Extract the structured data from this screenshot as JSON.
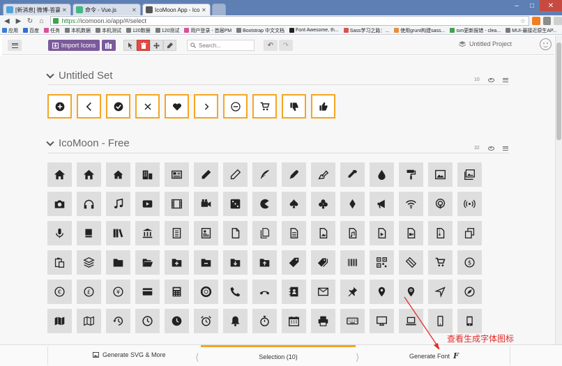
{
  "browser": {
    "tabs": [
      {
        "title": "[新消息] 微博-答赢职业人",
        "favicon_color": "#4fa3d9",
        "active": false
      },
      {
        "title": "命令 - Vue.js",
        "favicon_color": "#42b883",
        "active": false
      },
      {
        "title": "IcoMoon App - Icon Fo",
        "favicon_color": "#555555",
        "active": true
      }
    ],
    "url_https": "https://",
    "url_rest": "icomoon.io/app/#/select",
    "bookmarks": [
      {
        "label": "应用",
        "color": "#3b7ed3"
      },
      {
        "label": "百度",
        "color": "#2f6fd6"
      },
      {
        "label": "任务",
        "color": "#d94f9b"
      },
      {
        "label": "本机数据",
        "color": "#7a7a7a"
      },
      {
        "label": "本机测试",
        "color": "#7a7a7a"
      },
      {
        "label": "120数据",
        "color": "#7a7a7a"
      },
      {
        "label": "120测试",
        "color": "#7a7a7a"
      },
      {
        "label": "用户登录 - 首届PM",
        "color": "#d94f9b"
      },
      {
        "label": "Bootstrap 中文文档",
        "color": "#7a7a7a"
      },
      {
        "label": "Font Awesome, th...",
        "color": "#222222"
      },
      {
        "label": "Sass学习之路：...",
        "color": "#d9534f"
      },
      {
        "label": "使用grunt构建sass...",
        "color": "#e8903a"
      },
      {
        "label": "svn更新报错 - clea...",
        "color": "#3fa34d"
      },
      {
        "label": "MUI-最接近原生AP...",
        "color": "#7a7a7a"
      }
    ]
  },
  "toolbar": {
    "import_label": "Import Icons",
    "search_placeholder": "Search...",
    "project_label": "Untitled Project"
  },
  "sets": {
    "untitled": {
      "title": "Untitled Set",
      "count": "10"
    },
    "free": {
      "title": "IcoMoon - Free",
      "count": "32"
    }
  },
  "selected_icons": [
    "add-circle",
    "chevron-left",
    "check-circle",
    "cross",
    "heart",
    "chevron-right",
    "minus-circle",
    "cart",
    "thumbs-down",
    "thumbs-up"
  ],
  "free_icons": [
    "home",
    "home2",
    "home3",
    "office",
    "newspaper",
    "pencil",
    "pencil2",
    "quill",
    "pen",
    "blog",
    "eyedropper",
    "droplet",
    "paint-format",
    "image",
    "images",
    "camera",
    "headphones",
    "music",
    "play",
    "film",
    "video-camera",
    "dice",
    "pacman",
    "spades",
    "clubs",
    "diamonds",
    "bullhorn",
    "connection",
    "podcast",
    "feed",
    "mic",
    "book",
    "books",
    "library",
    "file-text",
    "profile",
    "file-empty",
    "files-empty",
    "file-text2",
    "file-picture",
    "file-music",
    "file-play",
    "file-video",
    "file-zip",
    "copy",
    "paste",
    "stack",
    "folder",
    "folder-open",
    "folder-plus",
    "folder-minus",
    "folder-download",
    "folder-upload",
    "price-tag",
    "price-tags",
    "barcode",
    "qrcode",
    "ticket",
    "cart",
    "coin-dollar",
    "coin-euro",
    "coin-pound",
    "coin-yen",
    "credit-card",
    "calculator",
    "lifebuoy",
    "phone",
    "phone-hang-up",
    "address-book",
    "envelop",
    "pushpin",
    "location",
    "location2",
    "compass",
    "compass2",
    "map",
    "map2",
    "history",
    "clock",
    "clock2",
    "alarm",
    "bell",
    "stopwatch",
    "calendar",
    "printer",
    "keyboard",
    "display",
    "laptop",
    "mobile",
    "mobile2"
  ],
  "bottom": {
    "svg_label": "Generate SVG & More",
    "selection_label": "Selection (10)",
    "font_label": "Generate Font"
  },
  "annotation": "查看生成字体图标",
  "colors": {
    "accent": "#f3a623",
    "purple": "#7b5a9c",
    "delete": "#e14a45",
    "annotation": "#e32b2b"
  }
}
